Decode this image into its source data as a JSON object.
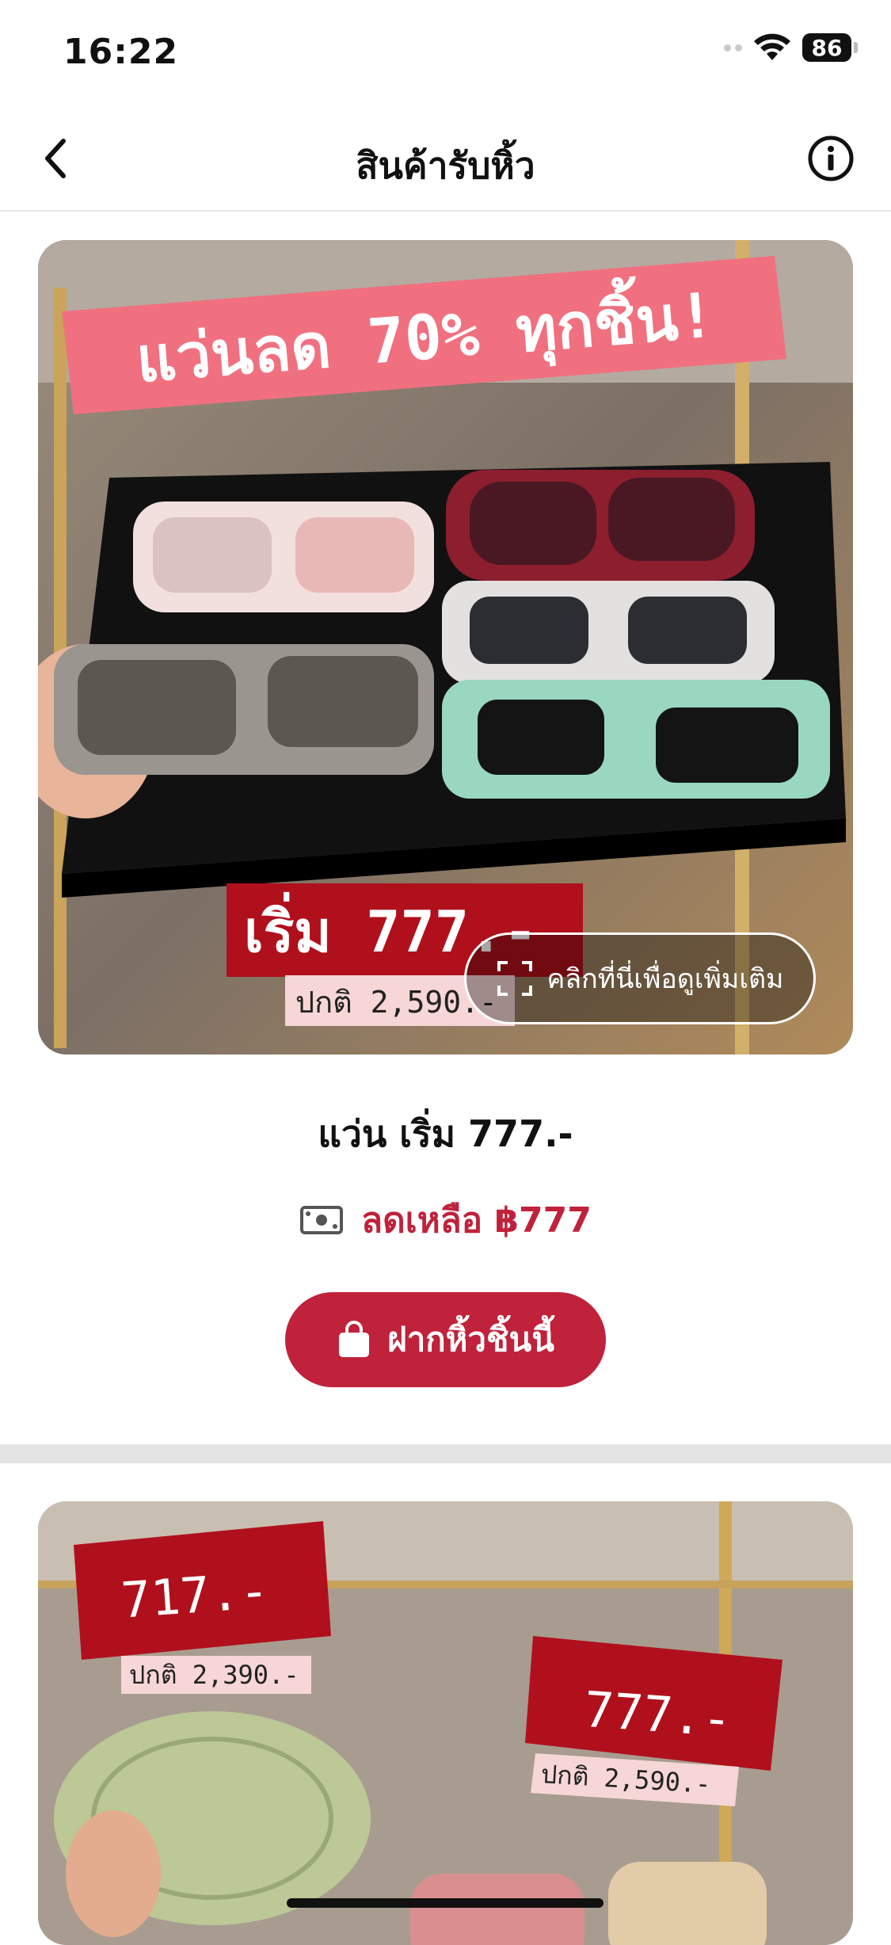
{
  "status_bar": {
    "time": "16:22",
    "battery": "86"
  },
  "nav": {
    "title": "สินค้ารับหิ้ว",
    "back_icon": "chevron-left-icon",
    "info_icon": "info-icon"
  },
  "products": [
    {
      "image_overlay": {
        "headline": "แว่นลด 70% ทุกชิ้น!",
        "price_tag": "เริ่ม 777.-",
        "original_tag": "ปกติ 2,590.-"
      },
      "more_label": "คลิกที่นี่เพื่อดูเพิ่มเติม",
      "name": "แว่น เริ่ม 777.-",
      "price_label": "ลดเหลือ ฿777",
      "reserve_label": "ฝากหิ้วชิ้นนี้"
    },
    {
      "image_overlay": {
        "price_tag_1": "717.-",
        "original_tag_1": "ปกติ 2,390.-",
        "price_tag_2": "777.-",
        "original_tag_2": "ปกติ 2,590.-"
      }
    }
  ],
  "colors": {
    "accent": "#c0223b",
    "price_tag_red": "#b0101c",
    "headline_pink": "#f07080"
  }
}
